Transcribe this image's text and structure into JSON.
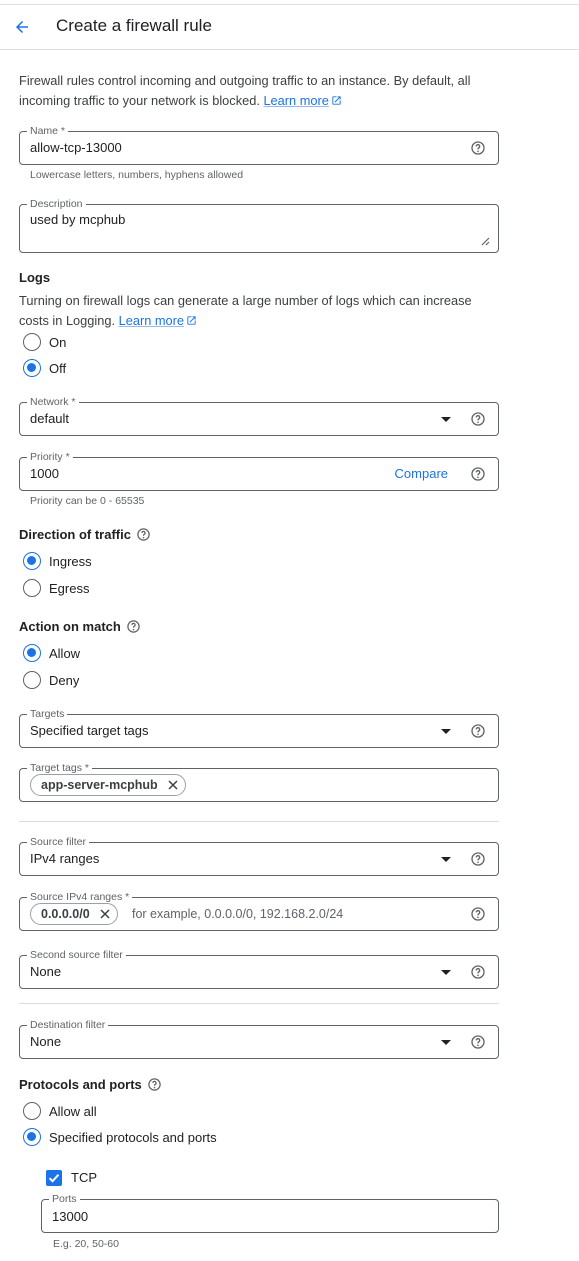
{
  "header": {
    "title": "Create a firewall rule"
  },
  "intro": {
    "text": "Firewall rules control incoming and outgoing traffic to an instance. By default, all incoming traffic to your network is blocked. ",
    "link": "Learn more"
  },
  "name_field": {
    "label": "Name *",
    "value": "allow-tcp-13000",
    "hint": "Lowercase letters, numbers, hyphens allowed"
  },
  "description_field": {
    "label": "Description",
    "value": "used by mcphub"
  },
  "logs": {
    "title": "Logs",
    "text": "Turning on firewall logs can generate a large number of logs which can increase costs in Logging. ",
    "link": "Learn more",
    "options": [
      "On",
      "Off"
    ],
    "selected": "Off"
  },
  "network_field": {
    "label": "Network *",
    "value": "default"
  },
  "priority_field": {
    "label": "Priority *",
    "value": "1000",
    "compare": "Compare",
    "hint": "Priority can be 0 - 65535"
  },
  "direction": {
    "title": "Direction of traffic",
    "options": [
      "Ingress",
      "Egress"
    ],
    "selected": "Ingress"
  },
  "action": {
    "title": "Action on match",
    "options": [
      "Allow",
      "Deny"
    ],
    "selected": "Allow"
  },
  "targets_field": {
    "label": "Targets",
    "value": "Specified target tags"
  },
  "target_tags_field": {
    "label": "Target tags *",
    "chips": [
      "app-server-mcphub"
    ]
  },
  "source_filter_field": {
    "label": "Source filter",
    "value": "IPv4 ranges"
  },
  "source_ranges_field": {
    "label": "Source IPv4 ranges *",
    "chips": [
      "0.0.0.0/0"
    ],
    "placeholder": "for example, 0.0.0.0/0, 192.168.2.0/24"
  },
  "second_source_field": {
    "label": "Second source filter",
    "value": "None"
  },
  "destination_field": {
    "label": "Destination filter",
    "value": "None"
  },
  "protocols": {
    "title": "Protocols and ports",
    "options": [
      "Allow all",
      "Specified protocols and ports"
    ],
    "selected": "Specified protocols and ports",
    "tcp_label": "TCP",
    "tcp_checked": true,
    "ports_label": "Ports",
    "ports_value": "13000",
    "ports_hint": "E.g. 20, 50-60"
  },
  "colors": {
    "accent": "#1a73e8",
    "border": "#5f6368",
    "text": "#202124"
  }
}
